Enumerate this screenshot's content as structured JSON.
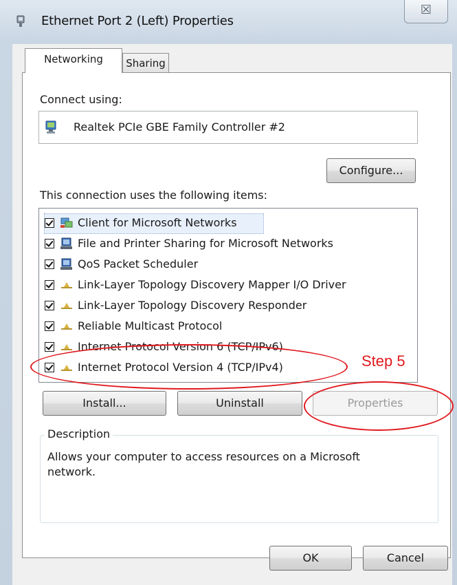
{
  "window": {
    "title": "Ethernet Port 2 (Left) Properties",
    "close_glyph": "☒"
  },
  "tabs": [
    {
      "label": "Networking",
      "active": true
    },
    {
      "label": "Sharing",
      "active": false
    }
  ],
  "connect_using": {
    "label": "Connect using:",
    "adapter": "Realtek PCIe GBE Family Controller #2",
    "adapter_icon": "network-adapter-icon"
  },
  "buttons": {
    "configure": "Configure...",
    "install": "Install...",
    "uninstall": "Uninstall",
    "properties": "Properties",
    "ok": "OK",
    "cancel": "Cancel"
  },
  "items_label": "This connection uses the following items:",
  "items": [
    {
      "label": "Client for Microsoft Networks",
      "checked": true,
      "icon": "network-client-icon"
    },
    {
      "label": "File and Printer Sharing for Microsoft Networks",
      "checked": true,
      "icon": "service-icon"
    },
    {
      "label": "QoS Packet Scheduler",
      "checked": true,
      "icon": "service-icon"
    },
    {
      "label": "Link-Layer Topology Discovery Mapper I/O Driver",
      "checked": true,
      "icon": "protocol-icon"
    },
    {
      "label": "Link-Layer Topology Discovery Responder",
      "checked": true,
      "icon": "protocol-icon"
    },
    {
      "label": "Reliable Multicast Protocol",
      "checked": true,
      "icon": "protocol-icon"
    },
    {
      "label": "Internet Protocol Version 6 (TCP/IPv6)",
      "checked": true,
      "icon": "protocol-icon"
    },
    {
      "label": "Internet Protocol Version 4 (TCP/IPv4)",
      "checked": true,
      "icon": "protocol-icon"
    }
  ],
  "description": {
    "legend": "Description",
    "text": "Allows your computer to access resources on a Microsoft network."
  },
  "annotation": {
    "step_label": "Step 5",
    "color": "#e0191e"
  }
}
